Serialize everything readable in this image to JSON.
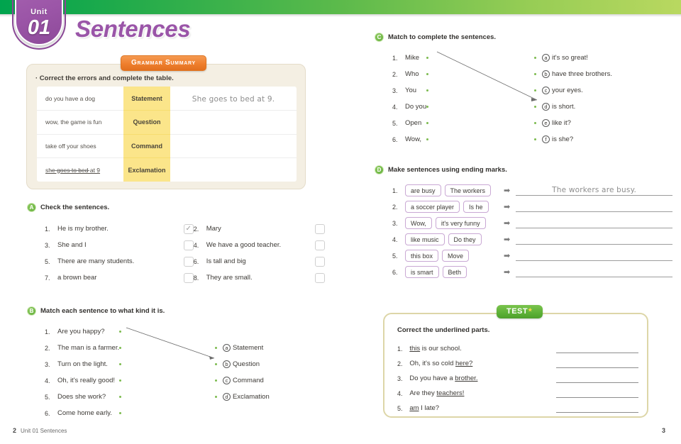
{
  "unit": {
    "label": "Unit",
    "number": "01"
  },
  "title": "Sentences",
  "grammar_summary": {
    "tab_label": "Grammar Summary",
    "caption": "· Correct the errors and complete the table.",
    "rows": [
      {
        "prompt": "do you have a dog",
        "type": "Statement",
        "answer": "She goes to bed at 9."
      },
      {
        "prompt": "wow, the game is fun",
        "type": "Question",
        "answer": ""
      },
      {
        "prompt": "take off your shoes",
        "type": "Command",
        "answer": ""
      },
      {
        "prompt": "she goes to bed at 9",
        "type": "Exclamation",
        "answer": ""
      }
    ]
  },
  "section_a": {
    "badge": "A",
    "title": "Check the sentences.",
    "items": [
      {
        "num": "1.",
        "text": "He is my brother.",
        "checked": true
      },
      {
        "num": "2.",
        "text": "Mary",
        "checked": false
      },
      {
        "num": "3.",
        "text": "She and I",
        "checked": false
      },
      {
        "num": "4.",
        "text": "We have a good teacher.",
        "checked": false
      },
      {
        "num": "5.",
        "text": "There are many students.",
        "checked": false
      },
      {
        "num": "6.",
        "text": "Is tall and big",
        "checked": false
      },
      {
        "num": "7.",
        "text": "a brown bear",
        "checked": false
      },
      {
        "num": "8.",
        "text": "They are small.",
        "checked": false
      }
    ],
    "check_mark": "✓"
  },
  "section_b": {
    "badge": "B",
    "title": "Match each sentence to what kind it is.",
    "left": [
      {
        "num": "1.",
        "text": "Are you happy?"
      },
      {
        "num": "2.",
        "text": "The man is a farmer."
      },
      {
        "num": "3.",
        "text": "Turn on the light."
      },
      {
        "num": "4.",
        "text": "Oh, it's really good!"
      },
      {
        "num": "5.",
        "text": "Does she work?"
      },
      {
        "num": "6.",
        "text": "Come home early."
      }
    ],
    "right": [
      {
        "key": "a",
        "text": "Statement"
      },
      {
        "key": "b",
        "text": "Question"
      },
      {
        "key": "c",
        "text": "Command"
      },
      {
        "key": "d",
        "text": "Exclamation"
      }
    ]
  },
  "section_c": {
    "badge": "C",
    "title": "Match to complete the sentences.",
    "left": [
      {
        "num": "1.",
        "text": "Mike"
      },
      {
        "num": "2.",
        "text": "Who"
      },
      {
        "num": "3.",
        "text": "You"
      },
      {
        "num": "4.",
        "text": "Do you"
      },
      {
        "num": "5.",
        "text": "Open"
      },
      {
        "num": "6.",
        "text": "Wow,"
      }
    ],
    "right": [
      {
        "key": "a",
        "text": "it's so great!"
      },
      {
        "key": "b",
        "text": "have three brothers."
      },
      {
        "key": "c",
        "text": "your eyes."
      },
      {
        "key": "d",
        "text": "is short."
      },
      {
        "key": "e",
        "text": "like it?"
      },
      {
        "key": "f",
        "text": "is she?"
      }
    ]
  },
  "section_d": {
    "badge": "D",
    "title": "Make sentences using ending marks.",
    "arrow": "➡",
    "items": [
      {
        "num": "1.",
        "tiles": [
          "are busy",
          "The workers"
        ],
        "answer": "The workers are busy."
      },
      {
        "num": "2.",
        "tiles": [
          "a soccer player",
          "Is he"
        ],
        "answer": ""
      },
      {
        "num": "3.",
        "tiles": [
          "Wow,",
          "it's very funny"
        ],
        "answer": ""
      },
      {
        "num": "4.",
        "tiles": [
          "like music",
          "Do they"
        ],
        "answer": ""
      },
      {
        "num": "5.",
        "tiles": [
          "this box",
          "Move"
        ],
        "answer": ""
      },
      {
        "num": "6.",
        "tiles": [
          "is smart",
          "Beth"
        ],
        "answer": ""
      }
    ]
  },
  "test": {
    "tab_label": "TEST",
    "caption": "Correct the underlined parts.",
    "items": [
      {
        "num": "1.",
        "before": "",
        "underlined": "this",
        "after": " is our school."
      },
      {
        "num": "2.",
        "before": "Oh, it's so cold ",
        "underlined": "here?",
        "after": ""
      },
      {
        "num": "3.",
        "before": "Do you have a ",
        "underlined": "brother.",
        "after": ""
      },
      {
        "num": "4.",
        "before": "Are they ",
        "underlined": "teachers!",
        "after": ""
      },
      {
        "num": "5.",
        "before": "",
        "underlined": "am",
        "after": " I late?"
      }
    ]
  },
  "footer": {
    "page_left": "2",
    "unit_text": "Unit 01  Sentences",
    "page_right": "3"
  },
  "colors": {
    "banner_start": "#00a44e",
    "banner_end": "#b9d860",
    "unit_purple": "#9b55a7",
    "title_purple": "#9a55a8",
    "orange_tab": "#ef7f2d",
    "yellow_cell": "#fbe58a",
    "green_badge": "#63b03c",
    "test_green": "#5cb036",
    "tile_border": "#c9a8d4",
    "box_cream": "#f4efe3"
  }
}
